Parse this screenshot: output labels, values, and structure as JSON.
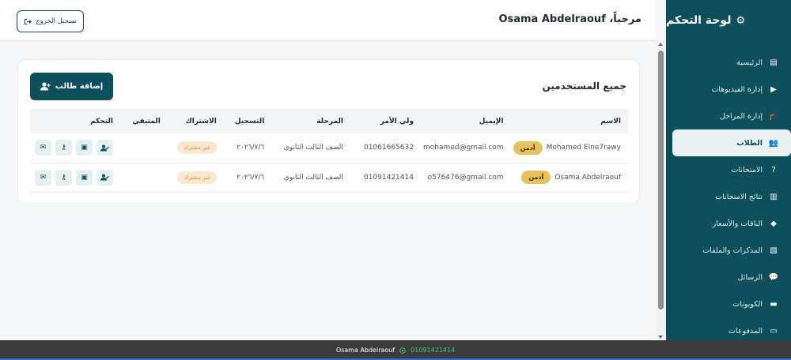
{
  "sidebar": {
    "brand_title": "لوحة التحكم",
    "brand_icon": "gears-icon",
    "items": [
      {
        "label": "الرئيسية",
        "icon": "chart-icon",
        "glyph": "▤",
        "active": false
      },
      {
        "label": "إدارة الفيديوهات",
        "icon": "video-icon",
        "glyph": "▶",
        "active": false
      },
      {
        "label": "إدارة المراحل",
        "icon": "graduation-cap-icon",
        "glyph": "🎓",
        "active": false
      },
      {
        "label": "الطلاب",
        "icon": "users-icon",
        "glyph": "👥",
        "active": true
      },
      {
        "label": "الامتحانات",
        "icon": "question-icon",
        "glyph": "?",
        "active": false
      },
      {
        "label": "نتائج الامتحانات",
        "icon": "poll-icon",
        "glyph": "▥",
        "active": false
      },
      {
        "label": "الباقات والأسعار",
        "icon": "tag-icon",
        "glyph": "◆",
        "active": false
      },
      {
        "label": "المذكرات والملفات",
        "icon": "file-icon",
        "glyph": "▧",
        "active": false
      },
      {
        "label": "الرسائل",
        "icon": "comments-icon",
        "glyph": "💬",
        "active": false
      },
      {
        "label": "الكوبونات",
        "icon": "ticket-icon",
        "glyph": "▬",
        "active": false
      },
      {
        "label": "المدفوعات",
        "icon": "credit-card-icon",
        "glyph": "▭",
        "active": false
      }
    ]
  },
  "topbar": {
    "welcome": "مرحباً، Osama Abdelraouf",
    "logout_label": "تسجيل الخروج"
  },
  "users": {
    "title": "جميع المستخدمين",
    "add_label": "إضافة طالب",
    "columns": [
      "الاسم",
      "الإيميل",
      "ولي الأمر",
      "المرحلة",
      "التسجيل",
      "الاشتراك",
      "المتبقي",
      "التحكم"
    ],
    "rows": [
      {
        "name": "Mohamed Elne7rawy",
        "role": "أدمن",
        "email": "mohamed@gmail.com",
        "guardian": "01061665632",
        "stage": "الصف الثالث الثانوي",
        "registered": "٢٠٢٦/٧/٦",
        "subscription": "غير مشترك",
        "remaining": ""
      },
      {
        "name": "Osama Abdelraouf",
        "role": "أدمن",
        "email": "o576476@gmail.com",
        "guardian": "01091421414",
        "stage": "الصف الثالث الثانوي",
        "registered": "٢٠٢٦/٧/٦",
        "subscription": "غير مشترك",
        "remaining": ""
      }
    ]
  },
  "footer": {
    "name": "Osama Abdelraouf",
    "phone": "01091421414"
  },
  "colors": {
    "primary": "#0d4f5a",
    "admin_badge": "#e6c35a",
    "sub_badge_bg": "#fde8cf",
    "whatsapp": "#4cc76a"
  }
}
